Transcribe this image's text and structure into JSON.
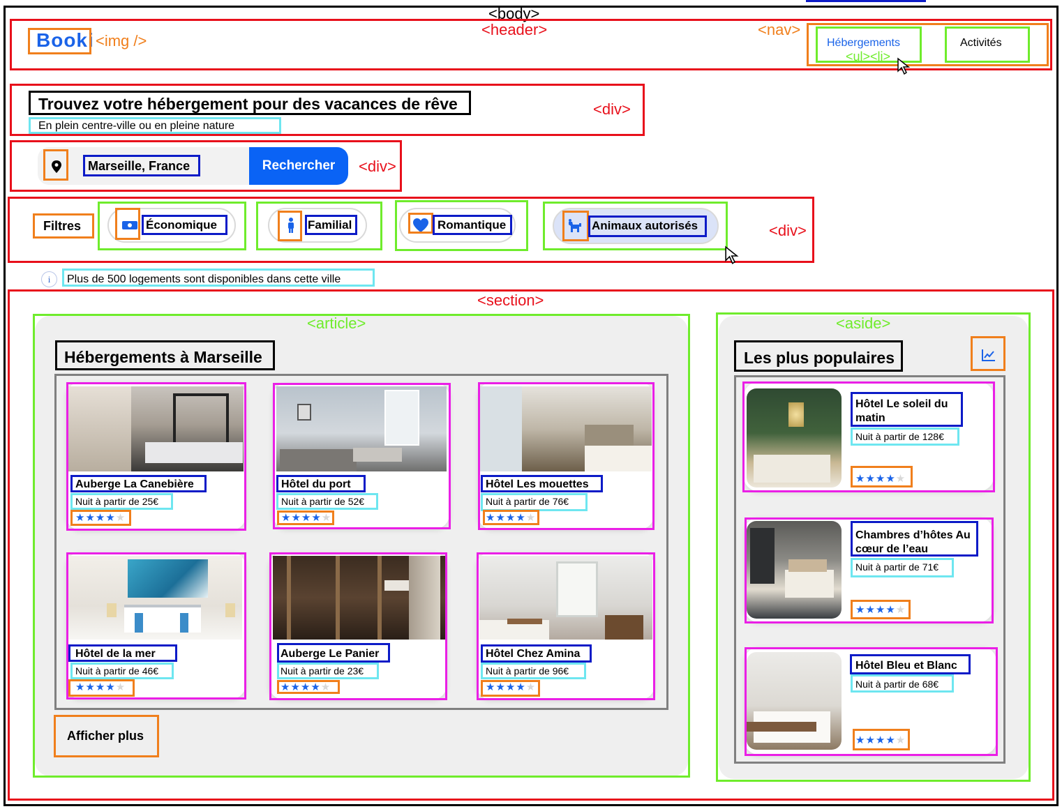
{
  "page_tag": "<body>",
  "header": {
    "tag": "<header>",
    "logo": "Booki",
    "logo_tag": "<img />",
    "nav_tag": "<nav>",
    "ul_tag": "<ul><li>",
    "nav": [
      {
        "label": "Hébergements",
        "active": true
      },
      {
        "label": "Activités",
        "active": false
      }
    ]
  },
  "hero": {
    "tag": "<div>",
    "title": "Trouvez votre hébergement pour des vacances de rêve",
    "subtitle": "En plein centre-ville ou en pleine nature"
  },
  "search": {
    "tag": "<div>",
    "location": "Marseille, France",
    "button": "Rechercher"
  },
  "filters": {
    "tag": "<div>",
    "label": "Filtres",
    "items": [
      {
        "label": "Économique",
        "icon": "money-icon",
        "selected": false
      },
      {
        "label": "Familial",
        "icon": "person-icon",
        "selected": false
      },
      {
        "label": "Romantique",
        "icon": "heart-icon",
        "selected": false
      },
      {
        "label": "Animaux autorisés",
        "icon": "dog-icon",
        "selected": true
      }
    ]
  },
  "info": {
    "icon": "info-icon",
    "text": "Plus de 500 logements sont disponibles dans cette ville"
  },
  "section": {
    "tag": "<section>",
    "article": {
      "tag": "<article>",
      "title": "Hébergements à Marseille",
      "cards": [
        {
          "name": "Auberge La Canebière",
          "price": "Nuit à partir de 25€",
          "rating": 4
        },
        {
          "name": "Hôtel du port",
          "price": "Nuit à partir de 52€",
          "rating": 4
        },
        {
          "name": "Hôtel Les mouettes",
          "price": "Nuit à partir de 76€",
          "rating": 4
        },
        {
          "name": "Hôtel de la mer",
          "price": "Nuit à partir de 46€",
          "rating": 4
        },
        {
          "name": "Auberge Le Panier",
          "price": "Nuit à partir de 23€",
          "rating": 4
        },
        {
          "name": "Hôtel Chez Amina",
          "price": "Nuit à partir de 96€",
          "rating": 4
        }
      ],
      "more_button": "Afficher plus"
    },
    "aside": {
      "tag": "<aside>",
      "title": "Les plus populaires",
      "icon": "trend-chart-icon",
      "cards": [
        {
          "name": "Hôtel Le soleil du matin",
          "price": "Nuit à partir de 128€",
          "rating": 4
        },
        {
          "name": "Chambres d’hôtes Au cœur de l’eau",
          "price": "Nuit à partir de 71€",
          "rating": 4
        },
        {
          "name": "Hôtel Bleu et Blanc",
          "price": "Nuit à partir de 68€",
          "rating": 4
        }
      ]
    }
  },
  "colors": {
    "brand": "#1a63e8",
    "button": "#0a63f5",
    "annot_red": "#e8101b",
    "annot_green": "#6fec2c",
    "annot_blue": "#0c1bc7",
    "annot_orange": "#f07f1c",
    "annot_cyan": "#6ee6f0",
    "annot_magenta": "#ea1fe6"
  }
}
